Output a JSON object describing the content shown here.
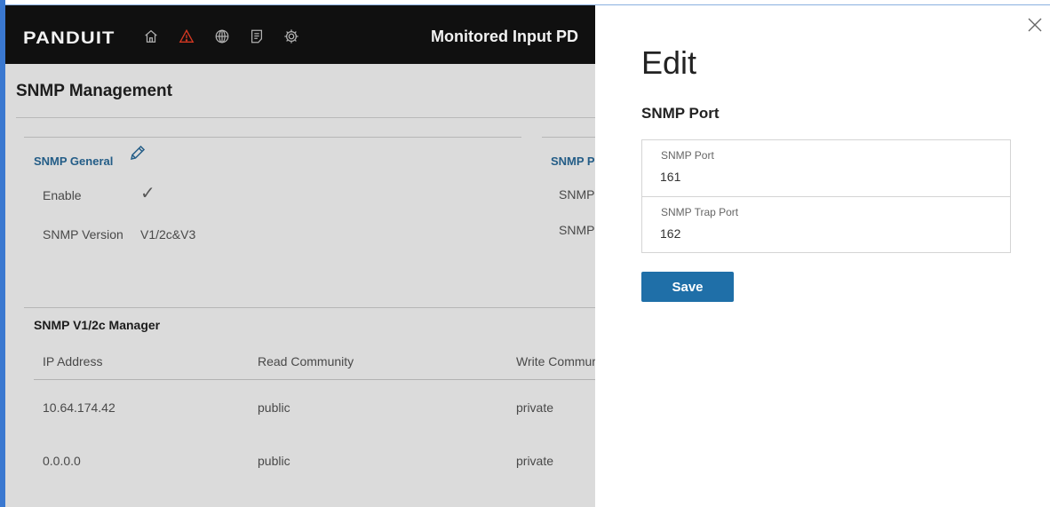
{
  "header": {
    "logo": "PANDUIT",
    "device_title": "Monitored Input PD",
    "icons": [
      "home-icon",
      "alert-icon",
      "globe-icon",
      "log-icon",
      "settings-icon"
    ],
    "alert_color": "#e03b24"
  },
  "page": {
    "title": "SNMP Management"
  },
  "snmp_general": {
    "title": "SNMP General",
    "enable_label": "Enable",
    "enable_value": "✓",
    "version_label": "SNMP Version",
    "version_value": "V1/2c&V3"
  },
  "snmp_port_card": {
    "title": "SNMP P",
    "row1_label": "SNMP",
    "row2_label": "SNMP"
  },
  "manager": {
    "title": "SNMP V1/2c Manager",
    "columns": [
      "IP Address",
      "Read Community",
      "Write Commur"
    ],
    "rows": [
      [
        "10.64.174.42",
        "public",
        "private"
      ],
      [
        "0.0.0.0",
        "public",
        "private"
      ]
    ]
  },
  "drawer": {
    "heading": "Edit",
    "section": "SNMP Port",
    "fields": [
      {
        "label": "SNMP Port",
        "value": "161"
      },
      {
        "label": "SNMP Trap Port",
        "value": "162"
      }
    ],
    "save_label": "Save",
    "accent_color": "#1f6fa8"
  }
}
